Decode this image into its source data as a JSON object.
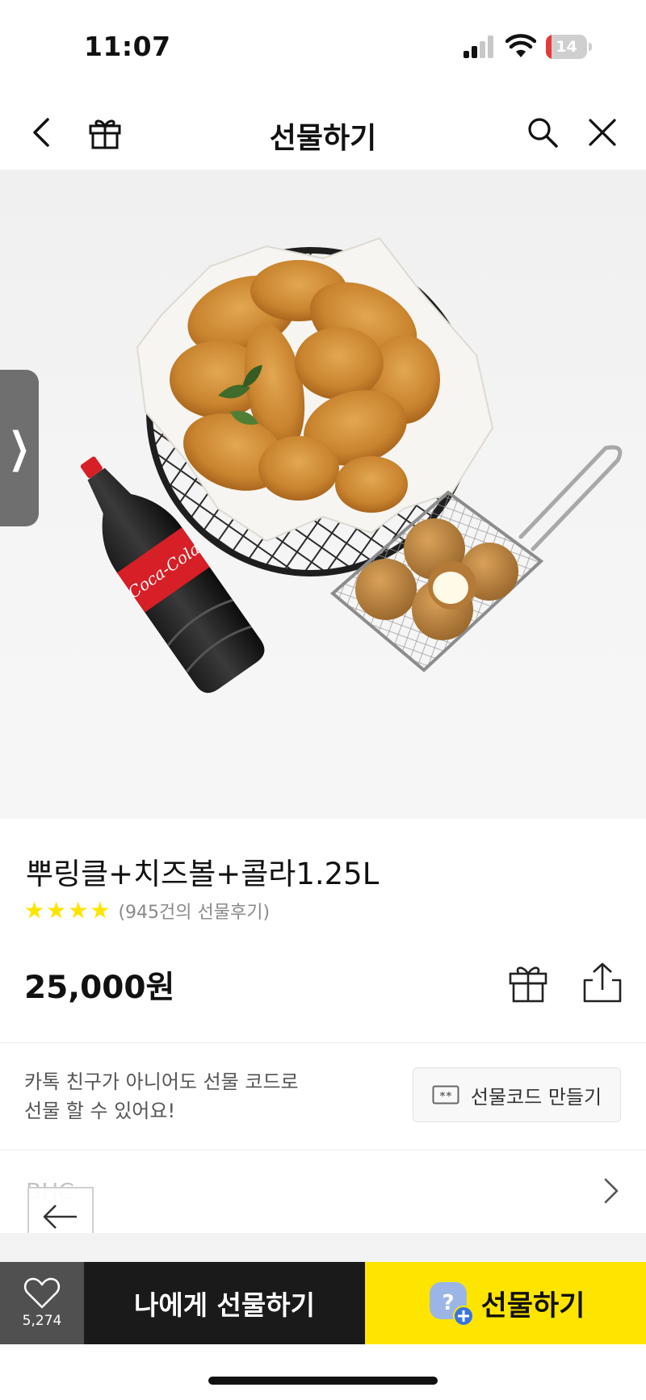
{
  "status_bar": {
    "time": "11:07",
    "battery_level": "14",
    "battery_fraction": 0.14,
    "signal_bars_active": 2,
    "signal_bars_total": 4
  },
  "header": {
    "title": "선물하기",
    "icons": [
      "chevron-left-icon",
      "gift-icon",
      "search-icon",
      "close-icon"
    ]
  },
  "hero": {
    "side_tab_glyph": "❯",
    "product_image_items": [
      "fried chicken basket",
      "Coca-Cola 1.25L bottle",
      "cheese balls basket"
    ]
  },
  "product": {
    "name": "뿌링클+치즈볼+콜라1.25L",
    "rating_stars": 4,
    "review_text": "(945건의 선물후기)",
    "price": "25,000원"
  },
  "gift_code": {
    "description_line1": "카톡 친구가 아니어도 선물 코드로",
    "description_line2": "선물 할 수 있어요!",
    "button_label": "선물코드 만들기"
  },
  "brand": {
    "name": "BHC"
  },
  "bottom_bar": {
    "like_count": "5,274",
    "self_gift_label": "나에게 선물하기",
    "gift_label": "선물하기"
  },
  "colors": {
    "kakao_yellow": "#fee500",
    "dark_button": "#1a1a1a",
    "like_button": "#505050",
    "battery_red": "#e5393a"
  }
}
